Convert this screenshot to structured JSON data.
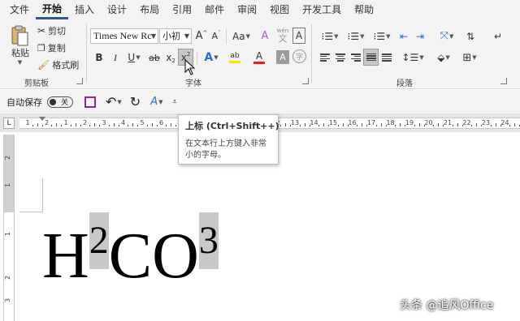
{
  "menu": {
    "tabs": [
      "文件",
      "开始",
      "插入",
      "设计",
      "布局",
      "引用",
      "邮件",
      "审阅",
      "视图",
      "开发工具",
      "帮助"
    ],
    "active_index": 1
  },
  "clipboard": {
    "paste_label": "粘贴",
    "cut_label": "剪切",
    "copy_label": "复制",
    "format_painter_label": "格式刷",
    "group_label": "剪贴板"
  },
  "font": {
    "font_name": "Times New Rc",
    "font_size": "小初",
    "grow_label": "A",
    "shrink_label": "A",
    "case_label": "Aa",
    "wen_label": "wén",
    "wen_char": "文",
    "bold_label": "B",
    "italic_label": "I",
    "underline_label": "U",
    "strike_label": "ab",
    "subscript_label": "x",
    "subscript_mark": "2",
    "superscript_label": "x",
    "superscript_mark": "2",
    "effects_label": "A",
    "highlight_label": "ab",
    "font_color_label": "A",
    "shading_label": "A",
    "enclose_char": "字",
    "group_label": "字体",
    "colors": {
      "highlight": "#f5e211",
      "font_color": "#e02020",
      "effects": "#2b6cd1"
    }
  },
  "paragraph": {
    "group_label": "段落"
  },
  "qat": {
    "autosave_label": "自动保存",
    "toggle_state": "关"
  },
  "tooltip": {
    "title": "上标 (Ctrl+Shift++)",
    "body": "在文本行上方键入非常小的字母。"
  },
  "ruler": {
    "labels": [
      "1",
      "2",
      "1",
      "2",
      "3",
      "4",
      "5",
      "6",
      "7",
      "8",
      "9",
      "10",
      "11",
      "12",
      "13",
      "14",
      "15",
      "16",
      "17",
      "18",
      "19",
      "20",
      "21",
      "22",
      "23",
      "24"
    ],
    "vertical_labels": [
      "2",
      "1",
      "1",
      "2",
      "3"
    ]
  },
  "document": {
    "formula": [
      {
        "text": "H",
        "selected": false,
        "superscript": false
      },
      {
        "text": "2",
        "selected": true,
        "superscript": true
      },
      {
        "text": "CO",
        "selected": false,
        "superscript": false
      },
      {
        "text": "3",
        "selected": true,
        "superscript": true
      }
    ]
  },
  "watermark": "头条 @追风Office"
}
